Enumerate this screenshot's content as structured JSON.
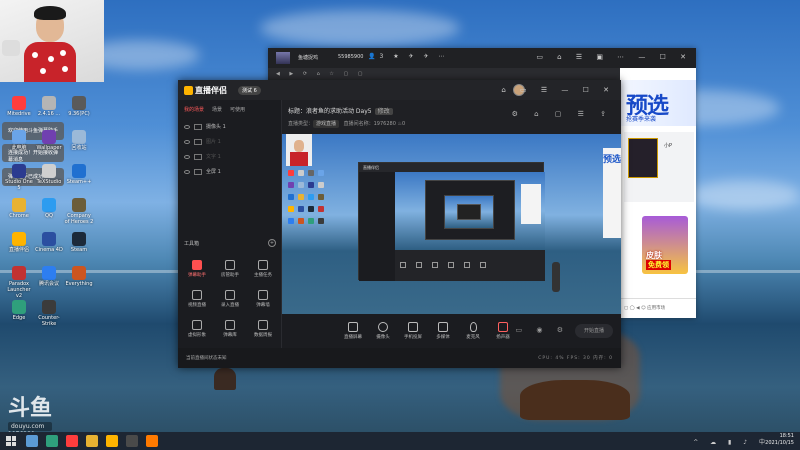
{
  "desktop": {
    "notifications": [
      "欢迎使用斗鱼弹幕助手",
      "连接成功！开始接收弹幕消息",
      "弹幕助手已成功"
    ],
    "icons": [
      {
        "label": "Mitedrive",
        "color": "#ff3d3d"
      },
      {
        "label": "2.4.16 ...",
        "color": "#b5b5b5"
      },
      {
        "label": "9.36(PC)",
        "color": "#5a5a5a"
      },
      {
        "label": "此电脑",
        "color": "#6aa4e8"
      },
      {
        "label": "Wallpaper",
        "color": "#7040b0"
      },
      {
        "label": "回收站",
        "color": "#9bb9d8"
      },
      {
        "label": "Studio One 5",
        "color": "#2b3b90"
      },
      {
        "label": "TeXStudio",
        "color": "#cfcfcf"
      },
      {
        "label": "Steam++",
        "color": "#2070d0"
      },
      {
        "label": "Chrome",
        "color": "#e8b232"
      },
      {
        "label": "QQ",
        "color": "#2d9cf0"
      },
      {
        "label": "Company of Heroes 2",
        "color": "#6b5d3a"
      },
      {
        "label": "直播伴侣",
        "color": "#ffb400"
      },
      {
        "label": "Cinema 4D",
        "color": "#2b4fa0"
      },
      {
        "label": "Steam",
        "color": "#1c2a3a"
      },
      {
        "label": "Paradox Launcher v2",
        "color": "#c23232"
      },
      {
        "label": "腾讯会议",
        "color": "#2d7ef0"
      },
      {
        "label": "Everything",
        "color": "#cc5520"
      },
      {
        "label": "Edge",
        "color": "#2f9f7c"
      },
      {
        "label": "Counter-Strike",
        "color": "#3b3b3b"
      }
    ],
    "watermark": {
      "logo": "斗鱼",
      "site": "douyu.com",
      "room_id": "1976280"
    }
  },
  "browser": {
    "streamer": "鱼塘捉鸡",
    "follow_id": "55985900",
    "viewers": "3",
    "banner_big": "预选",
    "banner_sub": "抢赛季来袭",
    "mini_label": "小P",
    "ad_label1": "皮肤",
    "ad_label2": "免费领",
    "footer": "应用市场"
  },
  "app": {
    "name": "直播伴侣",
    "version": "测试 6",
    "tabs": [
      "我的场景",
      "场景",
      "可使用"
    ],
    "scenes": [
      {
        "label": "摄像头 1",
        "dim": false
      },
      {
        "label": "图片 1",
        "dim": true
      },
      {
        "label": "文字 1",
        "dim": true
      },
      {
        "label": "全屏 1",
        "dim": false
      }
    ],
    "tools_title": "工具箱",
    "tools": [
      {
        "label": "弹幕助手",
        "red": true
      },
      {
        "label": "房管助手",
        "red": false
      },
      {
        "label": "主播任务",
        "red": false
      },
      {
        "label": "视频直播",
        "red": false
      },
      {
        "label": "录入直播",
        "red": false
      },
      {
        "label": "弹幕墙",
        "red": false
      },
      {
        "label": "虚拟形象",
        "red": false
      },
      {
        "label": "弹幕库",
        "red": false
      },
      {
        "label": "数据周报",
        "red": false
      }
    ],
    "room_title_label": "标题：",
    "room_title": "浪者鱼的求助活动 Day5",
    "room_tag": "修改",
    "room_category_label": "直播类型：",
    "room_category": "游戏直播",
    "room_stat": "直播间名称：1976280",
    "room_hot": "0",
    "toolbar": [
      "直播屏幕",
      "摄像头",
      "手机投屏",
      "多媒体",
      "麦克风",
      "扬声器"
    ],
    "start_button": "开始直播",
    "status_left": "当前直播间状态未知",
    "status_right": "CPU: 4%  FPS: 30  内存: 0",
    "footer": "ⓘ 当前直播间状态未知"
  },
  "taskbar": {
    "time": "18:51",
    "date": "2021/10/15",
    "apps": [
      "#5b9bd5",
      "#2f9f7c",
      "#ff3d3d",
      "#e8b232",
      "#ffb400",
      "#4a4a4a",
      "#ff7a00"
    ]
  }
}
